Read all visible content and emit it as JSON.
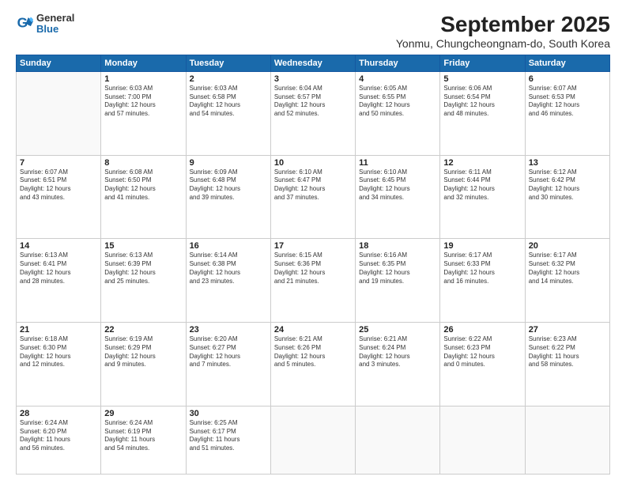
{
  "logo": {
    "general": "General",
    "blue": "Blue"
  },
  "title": "September 2025",
  "subtitle": "Yonmu, Chungcheongnam-do, South Korea",
  "weekdays": [
    "Sunday",
    "Monday",
    "Tuesday",
    "Wednesday",
    "Thursday",
    "Friday",
    "Saturday"
  ],
  "weeks": [
    [
      {
        "day": "",
        "info": ""
      },
      {
        "day": "1",
        "info": "Sunrise: 6:03 AM\nSunset: 7:00 PM\nDaylight: 12 hours\nand 57 minutes."
      },
      {
        "day": "2",
        "info": "Sunrise: 6:03 AM\nSunset: 6:58 PM\nDaylight: 12 hours\nand 54 minutes."
      },
      {
        "day": "3",
        "info": "Sunrise: 6:04 AM\nSunset: 6:57 PM\nDaylight: 12 hours\nand 52 minutes."
      },
      {
        "day": "4",
        "info": "Sunrise: 6:05 AM\nSunset: 6:55 PM\nDaylight: 12 hours\nand 50 minutes."
      },
      {
        "day": "5",
        "info": "Sunrise: 6:06 AM\nSunset: 6:54 PM\nDaylight: 12 hours\nand 48 minutes."
      },
      {
        "day": "6",
        "info": "Sunrise: 6:07 AM\nSunset: 6:53 PM\nDaylight: 12 hours\nand 46 minutes."
      }
    ],
    [
      {
        "day": "7",
        "info": "Sunrise: 6:07 AM\nSunset: 6:51 PM\nDaylight: 12 hours\nand 43 minutes."
      },
      {
        "day": "8",
        "info": "Sunrise: 6:08 AM\nSunset: 6:50 PM\nDaylight: 12 hours\nand 41 minutes."
      },
      {
        "day": "9",
        "info": "Sunrise: 6:09 AM\nSunset: 6:48 PM\nDaylight: 12 hours\nand 39 minutes."
      },
      {
        "day": "10",
        "info": "Sunrise: 6:10 AM\nSunset: 6:47 PM\nDaylight: 12 hours\nand 37 minutes."
      },
      {
        "day": "11",
        "info": "Sunrise: 6:10 AM\nSunset: 6:45 PM\nDaylight: 12 hours\nand 34 minutes."
      },
      {
        "day": "12",
        "info": "Sunrise: 6:11 AM\nSunset: 6:44 PM\nDaylight: 12 hours\nand 32 minutes."
      },
      {
        "day": "13",
        "info": "Sunrise: 6:12 AM\nSunset: 6:42 PM\nDaylight: 12 hours\nand 30 minutes."
      }
    ],
    [
      {
        "day": "14",
        "info": "Sunrise: 6:13 AM\nSunset: 6:41 PM\nDaylight: 12 hours\nand 28 minutes."
      },
      {
        "day": "15",
        "info": "Sunrise: 6:13 AM\nSunset: 6:39 PM\nDaylight: 12 hours\nand 25 minutes."
      },
      {
        "day": "16",
        "info": "Sunrise: 6:14 AM\nSunset: 6:38 PM\nDaylight: 12 hours\nand 23 minutes."
      },
      {
        "day": "17",
        "info": "Sunrise: 6:15 AM\nSunset: 6:36 PM\nDaylight: 12 hours\nand 21 minutes."
      },
      {
        "day": "18",
        "info": "Sunrise: 6:16 AM\nSunset: 6:35 PM\nDaylight: 12 hours\nand 19 minutes."
      },
      {
        "day": "19",
        "info": "Sunrise: 6:17 AM\nSunset: 6:33 PM\nDaylight: 12 hours\nand 16 minutes."
      },
      {
        "day": "20",
        "info": "Sunrise: 6:17 AM\nSunset: 6:32 PM\nDaylight: 12 hours\nand 14 minutes."
      }
    ],
    [
      {
        "day": "21",
        "info": "Sunrise: 6:18 AM\nSunset: 6:30 PM\nDaylight: 12 hours\nand 12 minutes."
      },
      {
        "day": "22",
        "info": "Sunrise: 6:19 AM\nSunset: 6:29 PM\nDaylight: 12 hours\nand 9 minutes."
      },
      {
        "day": "23",
        "info": "Sunrise: 6:20 AM\nSunset: 6:27 PM\nDaylight: 12 hours\nand 7 minutes."
      },
      {
        "day": "24",
        "info": "Sunrise: 6:21 AM\nSunset: 6:26 PM\nDaylight: 12 hours\nand 5 minutes."
      },
      {
        "day": "25",
        "info": "Sunrise: 6:21 AM\nSunset: 6:24 PM\nDaylight: 12 hours\nand 3 minutes."
      },
      {
        "day": "26",
        "info": "Sunrise: 6:22 AM\nSunset: 6:23 PM\nDaylight: 12 hours\nand 0 minutes."
      },
      {
        "day": "27",
        "info": "Sunrise: 6:23 AM\nSunset: 6:22 PM\nDaylight: 11 hours\nand 58 minutes."
      }
    ],
    [
      {
        "day": "28",
        "info": "Sunrise: 6:24 AM\nSunset: 6:20 PM\nDaylight: 11 hours\nand 56 minutes."
      },
      {
        "day": "29",
        "info": "Sunrise: 6:24 AM\nSunset: 6:19 PM\nDaylight: 11 hours\nand 54 minutes."
      },
      {
        "day": "30",
        "info": "Sunrise: 6:25 AM\nSunset: 6:17 PM\nDaylight: 11 hours\nand 51 minutes."
      },
      {
        "day": "",
        "info": ""
      },
      {
        "day": "",
        "info": ""
      },
      {
        "day": "",
        "info": ""
      },
      {
        "day": "",
        "info": ""
      }
    ]
  ]
}
